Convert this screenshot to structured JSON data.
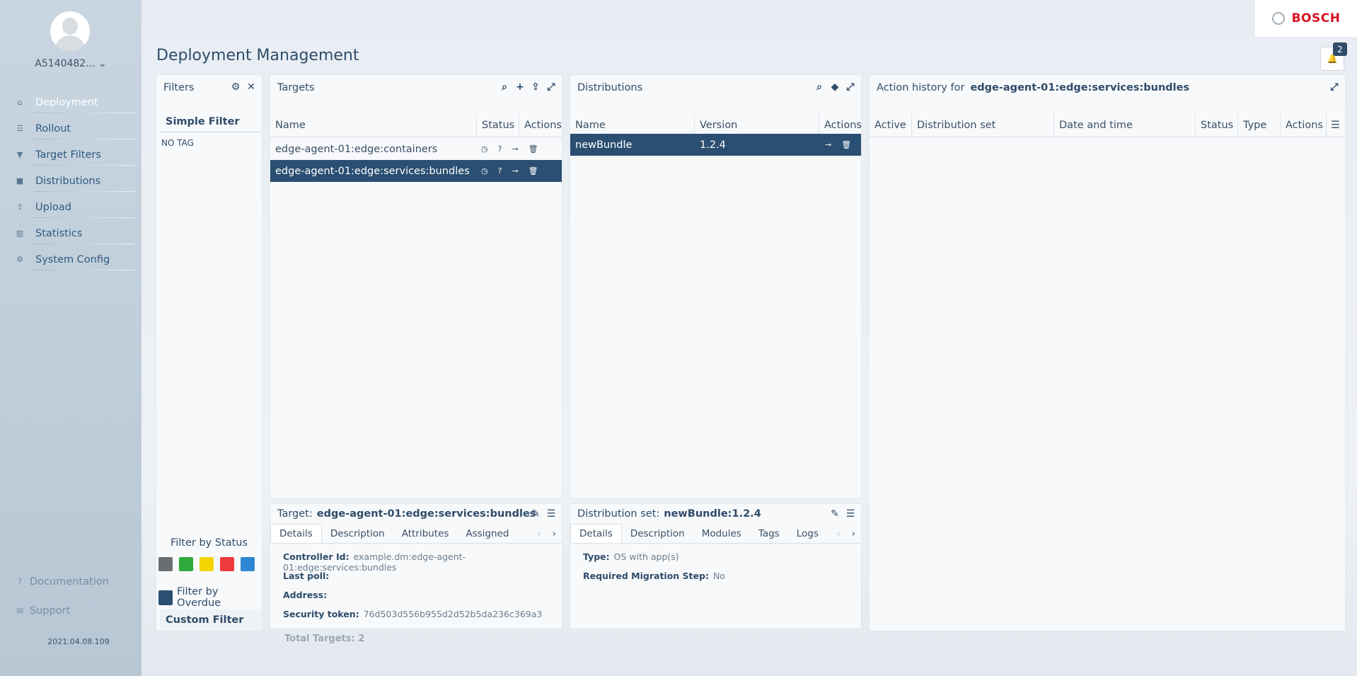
{
  "user": {
    "name": "A5140482... ⌄"
  },
  "nav": {
    "items": [
      {
        "label": "Deployment",
        "icon": "home-icon"
      },
      {
        "label": "Rollout",
        "icon": "list-icon"
      },
      {
        "label": "Target Filters",
        "icon": "filter-icon"
      },
      {
        "label": "Distributions",
        "icon": "briefcase-icon"
      },
      {
        "label": "Upload",
        "icon": "upload-icon"
      },
      {
        "label": "Statistics",
        "icon": "bar-chart-icon"
      },
      {
        "label": "System Config",
        "icon": "gear-icon"
      }
    ],
    "documentation": "Documentation",
    "support": "Support",
    "version": "2021.04.08.109"
  },
  "page": {
    "title": "Deployment Management"
  },
  "brand": {
    "name": "BOSCH"
  },
  "notifications": {
    "count": "2"
  },
  "filters": {
    "title": "Filters",
    "simple_filter": "Simple Filter",
    "no_tag": "NO TAG",
    "filter_by_status": "Filter by Status",
    "status_colors": [
      "#6b6e70",
      "#2faa3a",
      "#f2d400",
      "#ee3b3b",
      "#2e86d1"
    ],
    "filter_by_overdue": "Filter by Overdue",
    "custom_filter": "Custom Filter"
  },
  "targets": {
    "title": "Targets",
    "columns": [
      "Name",
      "Status",
      "Actions"
    ],
    "rows": [
      {
        "name": "edge-agent-01:edge:containers",
        "selected": false
      },
      {
        "name": "edge-agent-01:edge:services:bundles",
        "selected": true
      }
    ],
    "total": "Total Targets: 2"
  },
  "distributions": {
    "title": "Distributions",
    "columns": [
      "Name",
      "Version",
      "Actions"
    ],
    "rows": [
      {
        "name": "newBundle",
        "version": "1.2.4",
        "selected": true
      }
    ]
  },
  "action_history": {
    "title": "Action history for",
    "target": "edge-agent-01:edge:services:bundles",
    "columns": [
      "Active",
      "Distribution set",
      "Date and time",
      "Status",
      "Type",
      "Actions"
    ]
  },
  "target_details": {
    "label": "Target:",
    "name": "edge-agent-01:edge:services:bundles",
    "tabs": [
      "Details",
      "Description",
      "Attributes",
      "Assigned"
    ],
    "fields": [
      {
        "label": "Controller Id:",
        "value": "example.dm:edge-agent-01:edge:services:bundles"
      },
      {
        "label": "Last poll:",
        "value": ""
      },
      {
        "label": "Address:",
        "value": ""
      },
      {
        "label": "Security token:",
        "value": "76d503d556b955d2d52b5da236c369a3"
      }
    ]
  },
  "dist_details": {
    "label": "Distribution set:",
    "name": "newBundle:1.2.4",
    "tabs": [
      "Details",
      "Description",
      "Modules",
      "Tags",
      "Logs"
    ],
    "fields": [
      {
        "label": "Type:",
        "value": "OS with app(s)"
      },
      {
        "label": "Required Migration Step:",
        "value": "No"
      }
    ]
  }
}
